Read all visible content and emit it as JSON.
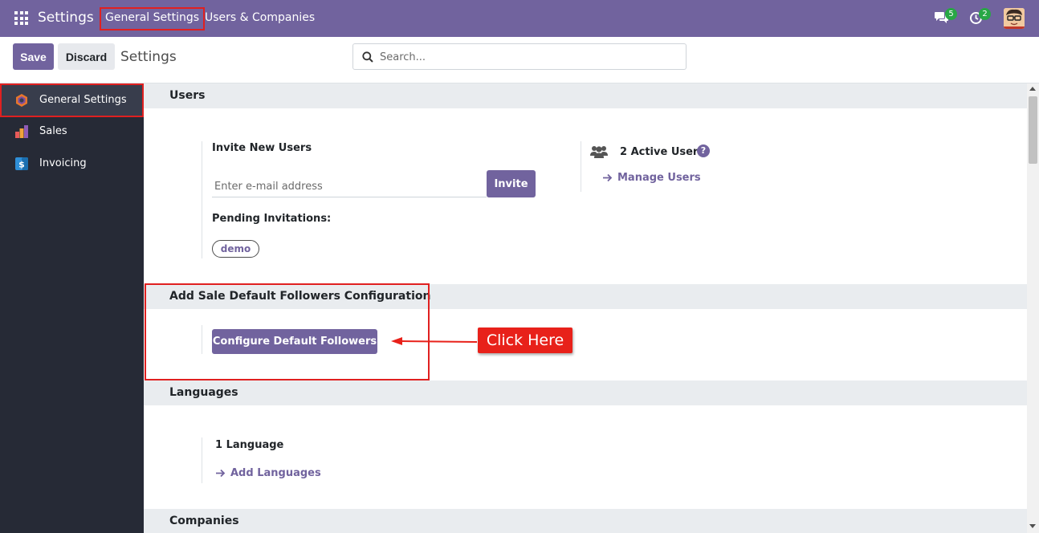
{
  "navbar": {
    "app_title": "Settings",
    "menu": [
      "General Settings",
      "Users & Companies"
    ],
    "chat_badge": "5",
    "activity_badge": "2",
    "background": "#71639e"
  },
  "control_panel": {
    "save_label": "Save",
    "discard_label": "Discard",
    "title": "Settings",
    "search_placeholder": "Search..."
  },
  "sidebar": {
    "items": [
      {
        "label": "General Settings",
        "icon": "general-settings-icon",
        "active": true
      },
      {
        "label": "Sales",
        "icon": "sales-icon",
        "active": false
      },
      {
        "label": "Invoicing",
        "icon": "invoicing-icon",
        "active": false
      }
    ]
  },
  "sections": {
    "users": {
      "header": "Users",
      "invite_title": "Invite New Users",
      "email_placeholder": "Enter e-mail address",
      "invite_button": "Invite",
      "pending_title": "Pending Invitations:",
      "pending_tags": [
        "demo"
      ],
      "active_users": "2 Active User",
      "help_glyph": "?",
      "manage_users": "Manage Users"
    },
    "followers": {
      "header": "Add Sale Default Followers Configuration",
      "configure_button": "Configure Default Followers"
    },
    "languages": {
      "header": "Languages",
      "count": "1 Language",
      "add_languages": "Add Languages"
    },
    "companies": {
      "header": "Companies"
    }
  },
  "annotation": {
    "label": "Click Here",
    "color": "#e8211a"
  }
}
